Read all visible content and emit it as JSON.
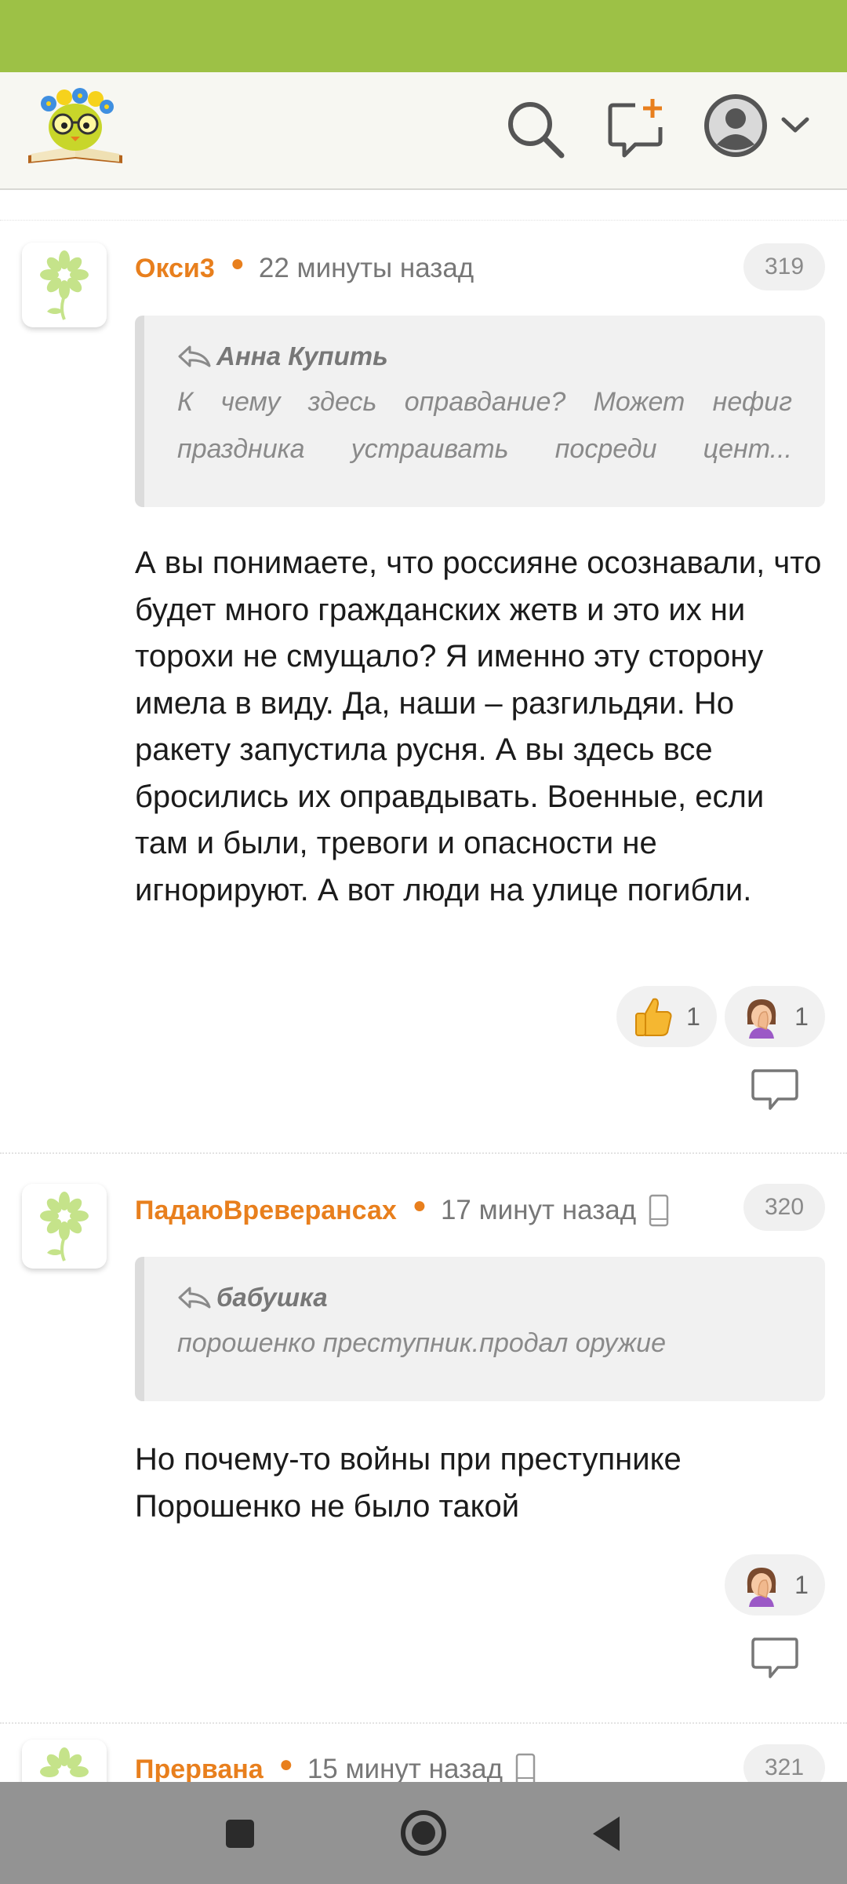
{
  "header": {
    "logo": "owl-reading-book-logo",
    "icons": [
      "search-icon",
      "new-post-icon",
      "avatar-icon",
      "chevron-down-icon"
    ]
  },
  "comments": [
    {
      "author": "Окси3",
      "time": "22 минуты назад",
      "number": "319",
      "quote_author": "Анна Купить",
      "quote_lines": [
        "К чему здесь оправдание? Может нефиг",
        "праздника устраивать посреди цент..."
      ],
      "body": "А вы понимаете, что россияне осознавали, что будет много гражданских жетв и это их ни торохи не смущало? Я именно эту сторону имела в виду. Да, наши – разгильдяи. Но ракету запустила русня. А вы здесь все бросились их оправдывать. Военные, если там и были, тревоги и опасности не игнорируют. А вот люди на улице погибли.",
      "reactions": [
        {
          "emoji": "thumbs-up",
          "count": "1"
        },
        {
          "emoji": "facepalm",
          "count": "1"
        }
      ]
    },
    {
      "author": "ПадаюВреверансах",
      "time": "17 минут назад",
      "number": "320",
      "quote_author": "бабушка",
      "quote_lines": [
        "порошенко преступник.продал оружие"
      ],
      "body": "Но почему-то войны при преступнике Порошенко не было такой",
      "reactions": [
        {
          "emoji": "facepalm",
          "count": "1"
        }
      ]
    },
    {
      "author": "Прервана",
      "time": "15 минут назад",
      "number": "321"
    }
  ],
  "colors": {
    "status_bar": "#9dc146",
    "username": "#e87f1d",
    "nav_bar": "#939393"
  },
  "nav": [
    "square-button",
    "home-button",
    "back-button"
  ]
}
